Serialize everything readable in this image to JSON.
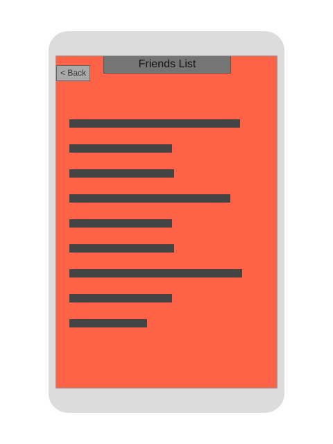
{
  "colors": {
    "screen_background": "#ff6347",
    "placeholder_bar": "#444444",
    "title_bar": "#757575",
    "back_button": "#a9a9a9",
    "device_frame": "#dcdcdc"
  },
  "header": {
    "title": "Friends List",
    "back_label": "< Back"
  },
  "friends": [
    {
      "name": "",
      "text_length": 0.88
    },
    {
      "name": "",
      "text_length": 0.53
    },
    {
      "name": "",
      "text_length": 0.54
    },
    {
      "name": "",
      "text_length": 0.83
    },
    {
      "name": "",
      "text_length": 0.53
    },
    {
      "name": "",
      "text_length": 0.54
    },
    {
      "name": "",
      "text_length": 0.89
    },
    {
      "name": "",
      "text_length": 0.53
    },
    {
      "name": "",
      "text_length": 0.4
    }
  ]
}
